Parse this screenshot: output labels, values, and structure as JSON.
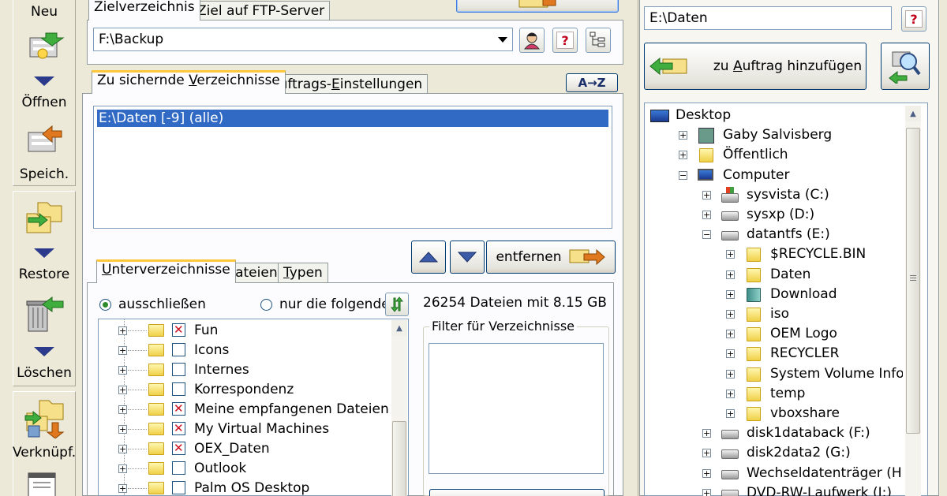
{
  "toolbar": {
    "new": "Neu",
    "open": "Öffnen",
    "save": "Speich.",
    "restore": "Restore",
    "delete": "Löschen",
    "link": "Verknüpf."
  },
  "target": {
    "tab_dir": "Zielverzeichnis",
    "tab_ftp": "Ziel auf FTP-Server",
    "path": "F:\\Backup"
  },
  "dirs_tabs": {
    "tab_dirs_pre": "Zu sichernde ",
    "tab_dirs_u": "V",
    "tab_dirs_post": "erzeichnisse",
    "tab_settings_pre": "Auftrags-",
    "tab_settings_u": "E",
    "tab_settings_post": "instellungen",
    "sort": "A→Z"
  },
  "dir_list": {
    "items": [
      "E:\\Daten [-9] (alle)"
    ]
  },
  "remove_button": "entfernen",
  "sub_tabs": {
    "sub_u": "U",
    "sub_rest": "nterverzeichnisse",
    "files_u": "D",
    "files_rest": "ateien",
    "types_u": "T",
    "types_rest": "ypen"
  },
  "filter": {
    "exclude": "ausschließen",
    "only": "nur die folgenden",
    "summary": "26254 Dateien mit 8.15 GB",
    "group_title": "Filter für Verzeichnisse"
  },
  "subfolders": [
    {
      "name": "Fun",
      "checked": true
    },
    {
      "name": "Icons",
      "checked": false
    },
    {
      "name": "Internes",
      "checked": false
    },
    {
      "name": "Korrespondenz",
      "checked": false
    },
    {
      "name": "Meine empfangenen Dateien",
      "checked": true
    },
    {
      "name": "My Virtual Machines",
      "checked": true
    },
    {
      "name": "OEX_Daten",
      "checked": true
    },
    {
      "name": "Outlook",
      "checked": false
    },
    {
      "name": "Palm OS Desktop",
      "checked": false
    }
  ],
  "source": {
    "path": "E:\\Daten",
    "add_pre": "zu ",
    "add_u": "A",
    "add_post": "uftrag hinzufügen"
  },
  "tree": {
    "desktop": "Desktop",
    "gaby": "Gaby Salvisberg",
    "public": "Öffentlich",
    "computer": "Computer",
    "c": "sysvista (C:)",
    "d": "sysxp (D:)",
    "e": "datantfs (E:)",
    "e_children": [
      "$RECYCLE.BIN",
      "Daten",
      "Download",
      "iso",
      "OEM Logo",
      "RECYCLER",
      "System Volume Informatior",
      "temp",
      "vboxshare"
    ],
    "f": "disk1databack (F:)",
    "g": "disk2data2 (G:)",
    "h": "Wechseldatenträger (H:)",
    "i": "DVD-RW-Laufwerk (I:)"
  }
}
